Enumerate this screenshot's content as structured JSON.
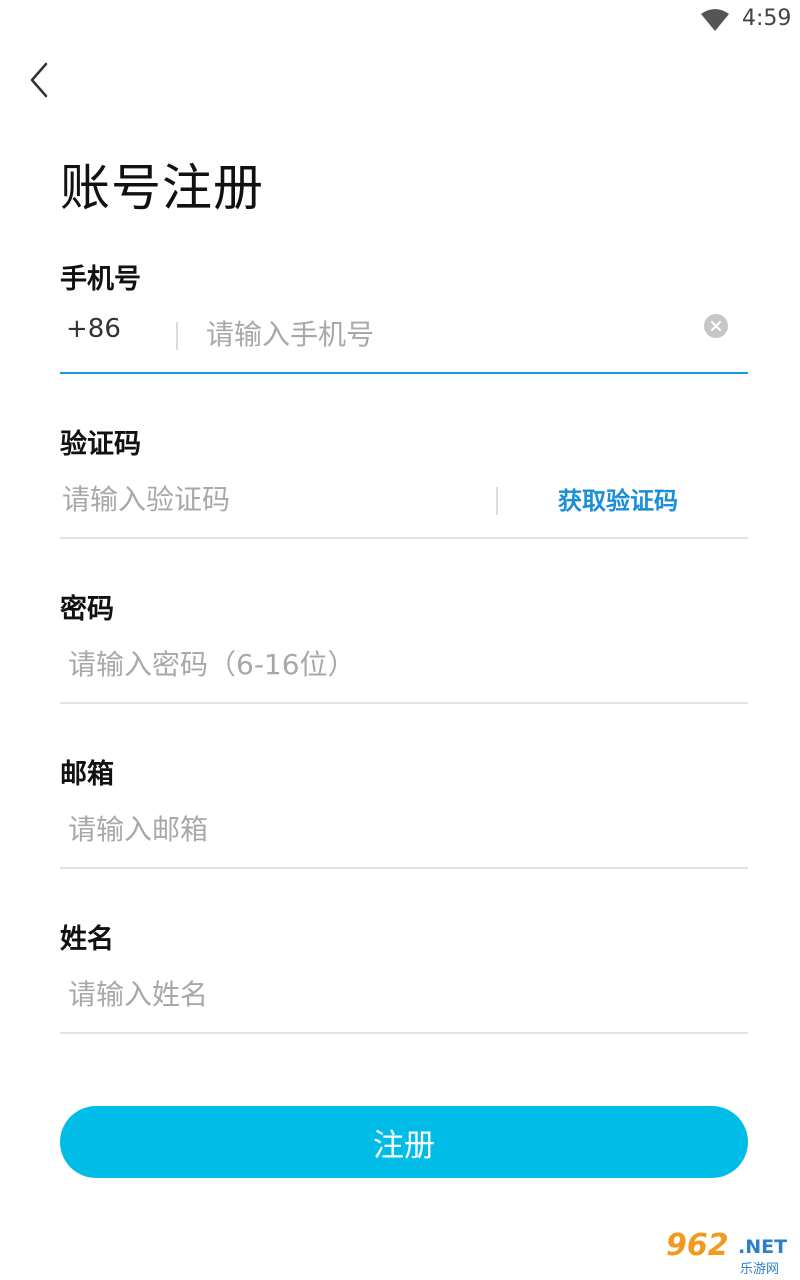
{
  "status_bar": {
    "time": "4:59",
    "wifi_icon": "wifi-icon"
  },
  "header": {
    "back_icon": "chevron-left-icon",
    "title": "账号注册"
  },
  "form": {
    "phone": {
      "label": "手机号",
      "country_code": "+86",
      "placeholder": "请输入手机号",
      "value": "",
      "clear_icon": "clear-icon"
    },
    "code": {
      "label": "验证码",
      "placeholder": "请输入验证码",
      "value": "",
      "get_code_label": "获取验证码"
    },
    "password": {
      "label": "密码",
      "placeholder": "请输入密码（6-16位）",
      "value": ""
    },
    "email": {
      "label": "邮箱",
      "placeholder": "请输入邮箱",
      "value": ""
    },
    "name": {
      "label": "姓名",
      "placeholder": "请输入姓名",
      "value": ""
    }
  },
  "submit": {
    "label": "注册"
  },
  "watermark": {
    "brand": "962",
    "domain": ".NET",
    "subtitle": "乐游网"
  },
  "colors": {
    "accent": "#00bde8",
    "link": "#1a8fd8",
    "active_underline": "#1a9bd7"
  }
}
